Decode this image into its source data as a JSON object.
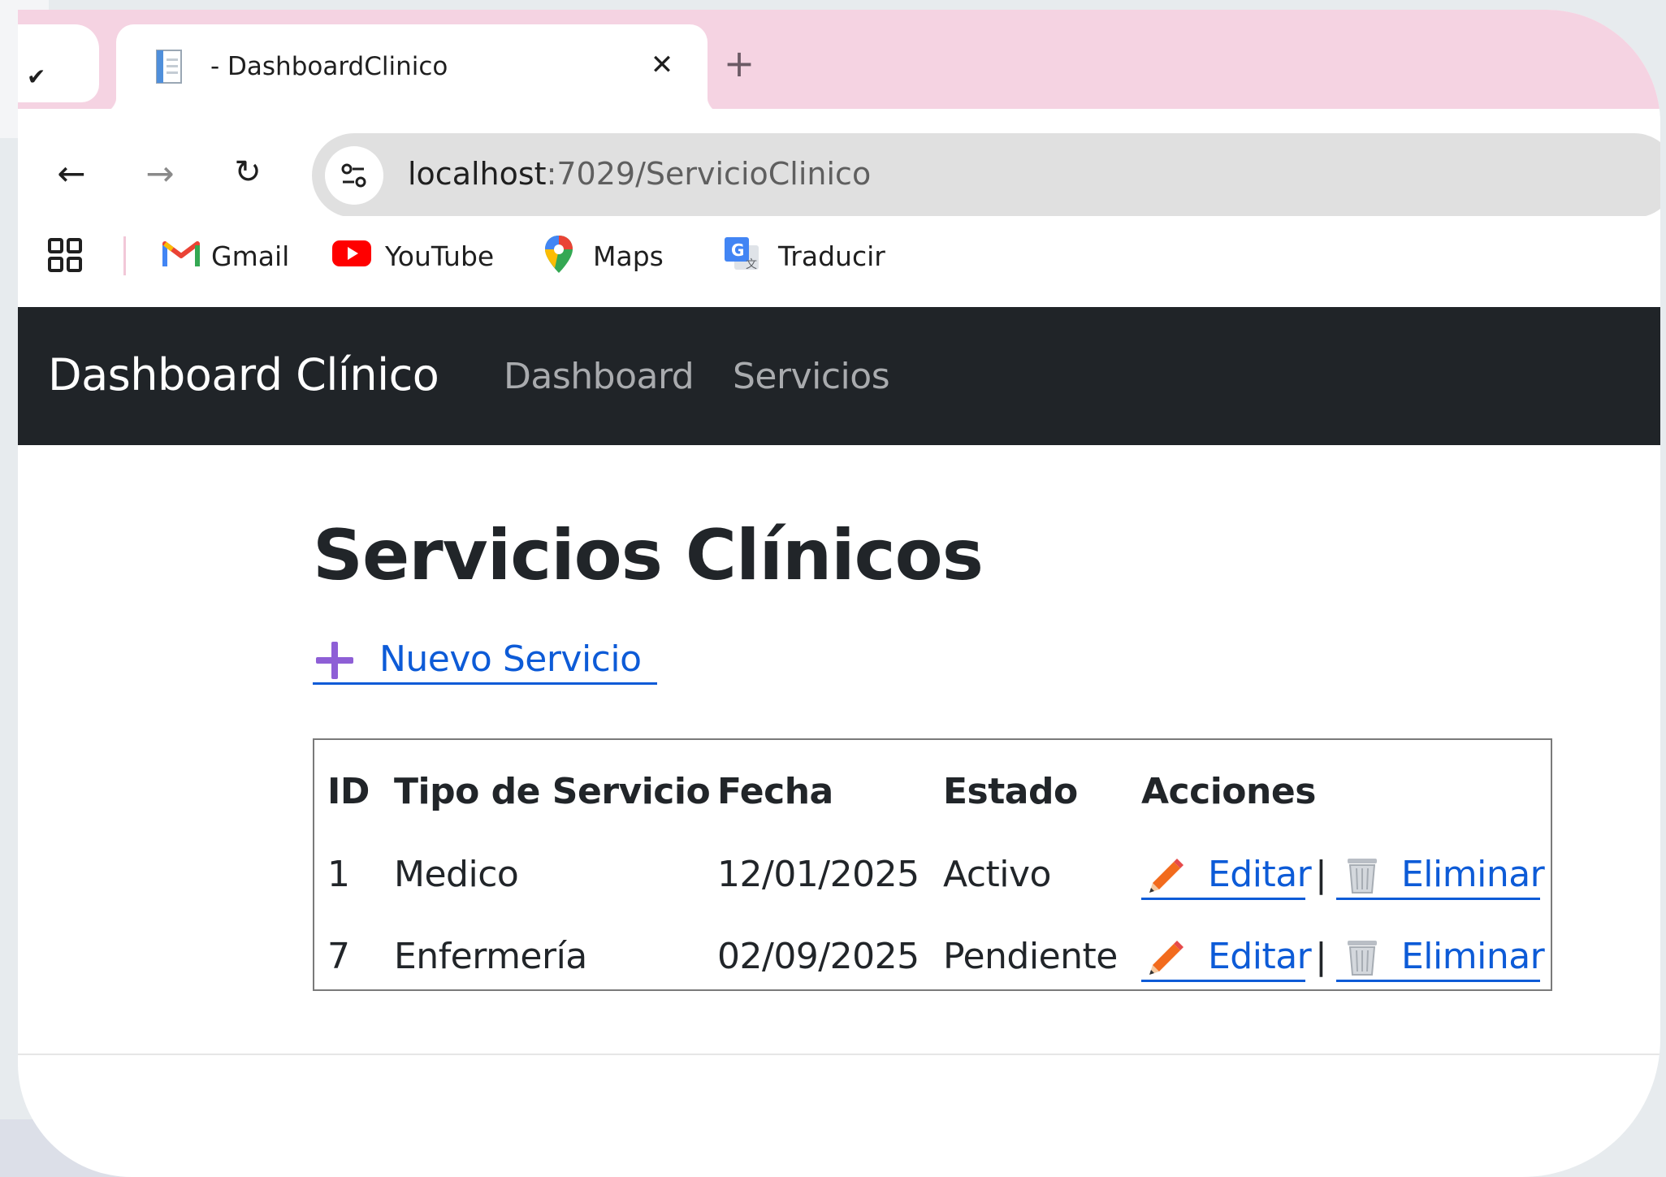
{
  "browser": {
    "tab_title": "- DashboardClinico",
    "new_tab_glyph": "+",
    "close_glyph": "✕",
    "url_host": "localhost",
    "url_path": ":7029/ServicioClinico",
    "bookmarks": [
      {
        "label": "Gmail",
        "icon": "gmail-icon"
      },
      {
        "label": "YouTube",
        "icon": "youtube-icon"
      },
      {
        "label": "Maps",
        "icon": "maps-icon"
      },
      {
        "label": "Traducir",
        "icon": "translate-icon"
      }
    ]
  },
  "app": {
    "brand": "Dashboard Clínico",
    "nav": [
      {
        "label": "Dashboard"
      },
      {
        "label": "Servicios"
      }
    ]
  },
  "page": {
    "title": "Servicios Clínicos",
    "new_service_label": "Nuevo Servicio"
  },
  "table": {
    "headers": [
      "ID",
      "Tipo de Servicio",
      "Fecha",
      "Estado",
      "Acciones"
    ],
    "rows": [
      {
        "id": "1",
        "tipo": "Medico",
        "fecha": "12/01/2025",
        "estado": "Activo"
      },
      {
        "id": "7",
        "tipo": "Enfermería",
        "fecha": "02/09/2025",
        "estado": "Pendiente"
      }
    ],
    "edit_label": "Editar",
    "delete_label": "Eliminar",
    "separator": "|"
  },
  "colors": {
    "tabstrip": "#f5d3e2",
    "navbar": "#202428",
    "link": "#0d5bd7",
    "omnibox": "#e0e0e0"
  }
}
